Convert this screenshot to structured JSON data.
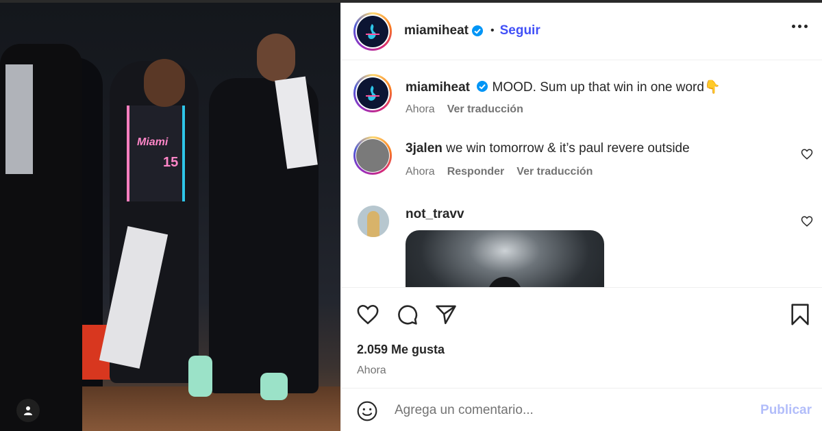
{
  "post": {
    "author": "miamiheat",
    "separator": "•",
    "follow_label": "Seguir",
    "verified": true
  },
  "caption": {
    "username": "miamiheat",
    "text": "MOOD. Sum up that win in one word👇",
    "time": "Ahora",
    "translate_label": "Ver traducción"
  },
  "comments": [
    {
      "username": "3jalen",
      "text": "we win tomorrow & it’s paul revere outside",
      "time": "Ahora",
      "reply_label": "Responder",
      "translate_label": "Ver traducción"
    },
    {
      "username": "not_travv",
      "text": ""
    }
  ],
  "photo": {
    "jersey_text": "Miami",
    "jersey_number": "15"
  },
  "engagement": {
    "likes": "2.059 Me gusta",
    "time": "Ahora"
  },
  "composer": {
    "placeholder": "Agrega un comentario...",
    "publish_label": "Publicar"
  },
  "colors": {
    "accent": "#4150f7",
    "publish_disabled": "#b2bdfa",
    "verified": "#0095f6",
    "muted_text": "#737373"
  },
  "icons": [
    "verified-icon",
    "more-icon",
    "heart-icon",
    "comment-icon",
    "share-icon",
    "bookmark-icon",
    "emoji-icon",
    "user-tag-icon"
  ]
}
